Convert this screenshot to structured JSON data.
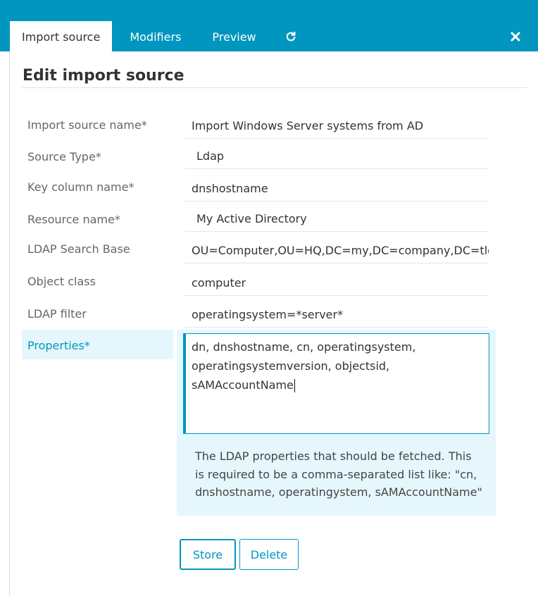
{
  "tabs": {
    "import_source": "Import source",
    "modifiers": "Modifiers",
    "preview": "Preview"
  },
  "page_title": "Edit import source",
  "fields": {
    "import_source_name": {
      "label": "Import source name*",
      "value": "Import Windows Server systems from AD"
    },
    "source_type": {
      "label": "Source Type*",
      "value": "Ldap"
    },
    "key_column_name": {
      "label": "Key column name*",
      "value": "dnshostname"
    },
    "resource_name": {
      "label": "Resource name*",
      "value": "My Active Directory"
    },
    "ldap_search_base": {
      "label": "LDAP Search Base",
      "value": "OU=Computer,OU=HQ,DC=my,DC=company,DC=tld"
    },
    "object_class": {
      "label": "Object class",
      "value": "computer"
    },
    "ldap_filter": {
      "label": "LDAP filter",
      "value": "operatingsystem=*server*"
    },
    "properties": {
      "label": "Properties*",
      "line1": "dn, dnshostname, cn, operatingsystem,",
      "line2": "operatingsystemversion, objectsid, sAMAccountName",
      "help": "The LDAP properties that should be fetched. This is required to be a comma-separated list like: \"cn, dnshostname, operatingystem, sAMAccountName\""
    }
  },
  "buttons": {
    "store": "Store",
    "delete": "Delete"
  },
  "icons": {
    "refresh": "refresh-icon",
    "close": "close-icon"
  },
  "colors": {
    "accent": "#0096bf",
    "highlight": "#e5f7fd"
  }
}
